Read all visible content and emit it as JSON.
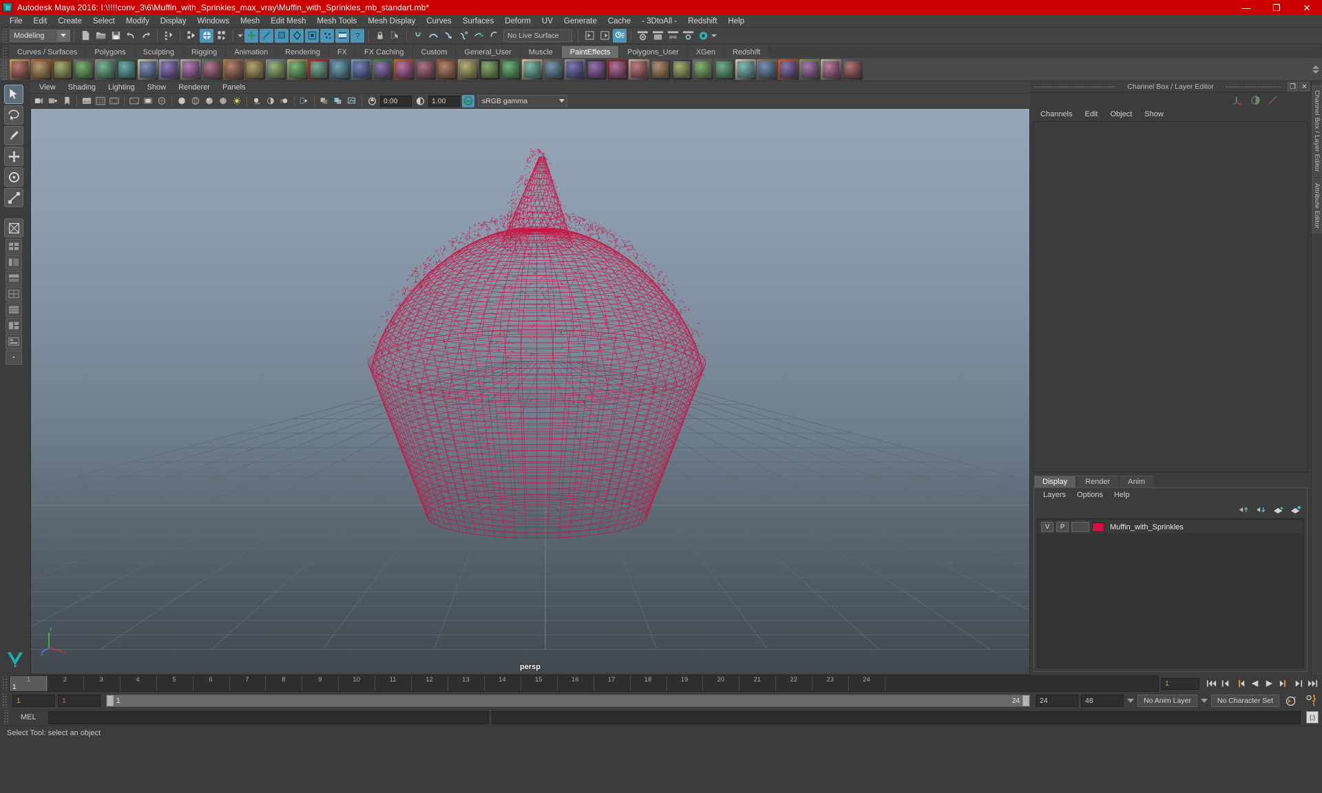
{
  "window": {
    "title": "Autodesk Maya 2016: I:\\!!!!conv_3\\6\\Muffin_with_Sprinkles_max_vray\\Muffin_with_Sprinkles_mb_standart.mb*",
    "minimize": "—",
    "maximize": "❐",
    "close": "✕",
    "titlebar_color": "#cc0000"
  },
  "menubar": {
    "items": [
      "File",
      "Edit",
      "Create",
      "Select",
      "Modify",
      "Display",
      "Windows",
      "Mesh",
      "Edit Mesh",
      "Mesh Tools",
      "Mesh Display",
      "Curves",
      "Surfaces",
      "Deform",
      "UV",
      "Generate",
      "Cache",
      "- 3DtoAll -",
      "Redshift",
      "Help"
    ]
  },
  "statusline": {
    "mode": "Modeling",
    "live_surface": "No Live Surface"
  },
  "shelf": {
    "tabs": [
      "Curves / Surfaces",
      "Polygons",
      "Sculpting",
      "Rigging",
      "Animation",
      "Rendering",
      "FX",
      "FX Caching",
      "Custom",
      "General_User",
      "Muscle",
      "PaintEffects",
      "Polygons_User",
      "XGen",
      "Redshift"
    ],
    "active_tab": "PaintEffects",
    "icon_colors": [
      "#c8a060",
      "#b86a3a",
      "#7a5030",
      "#6a6a6a",
      "#8a8a8a",
      "#3a5a3a",
      "#c8c8b0",
      "#9aa8b8",
      "#b0b0a0",
      "#5a7a5a",
      "#a08050",
      "#8a6a4a",
      "#7a8a9a",
      "#c0a070",
      "#b03030",
      "#5a7a9a",
      "#7a9ab0",
      "#4a8a4a",
      "#c06030",
      "#606060",
      "#8a5a3a",
      "#a09070",
      "#3a3a3a",
      "#507050",
      "#d0c0a0",
      "#7a6a5a",
      "#909090",
      "#404040",
      "#8a3030",
      "#c0b0a0",
      "#505050",
      "#3a4a5a",
      "#707070",
      "#5a5a5a",
      "#d8c8b8",
      "#8a7a6a",
      "#c86030",
      "#7a9a60",
      "#b8b0a0",
      "#5a5a6a"
    ]
  },
  "viewport": {
    "menus": [
      "View",
      "Shading",
      "Lighting",
      "Show",
      "Renderer",
      "Panels"
    ],
    "exposure": "0.00",
    "gamma": "1.00",
    "color_profile": "sRGB gamma",
    "camera_label": "persp",
    "wireframe_color": "#cc1040",
    "axis_labels": {
      "x": "x",
      "y": "y",
      "z": "z"
    }
  },
  "channelbox": {
    "panel_title": "Channel Box / Layer Editor",
    "menus": [
      "Channels",
      "Edit",
      "Object",
      "Show"
    ],
    "undock_glyph": "❐",
    "close_glyph": "✕",
    "dock_label": "Channel Box / Layer Editor",
    "dock_label_2": "Attribute Editor"
  },
  "layereditor": {
    "tabs": [
      "Display",
      "Render",
      "Anim"
    ],
    "active_tab": "Display",
    "menus": [
      "Layers",
      "Options",
      "Help"
    ],
    "layers": [
      {
        "visible": "V",
        "playback": "P",
        "type": "",
        "color": "#cc1040",
        "name": "Muffin_with_Sprinkles"
      }
    ]
  },
  "timeline": {
    "ticks": [
      1,
      2,
      3,
      4,
      5,
      6,
      7,
      8,
      9,
      10,
      11,
      12,
      13,
      14,
      15,
      16,
      17,
      18,
      19,
      20,
      21,
      22,
      23,
      24
    ],
    "current_frame_label": "1",
    "current_frame_field": "1",
    "range_start": "1",
    "range_end": "1",
    "playback_start": "1",
    "playback_end": "24",
    "anim_start": "24",
    "anim_end": "48",
    "anim_layer": "No Anim Layer",
    "character_set": "No Character Set"
  },
  "commandline": {
    "label": "MEL",
    "input_value": "",
    "output_value": ""
  },
  "statusbar": {
    "message": "Select Tool: select an object"
  },
  "toolbox": {
    "tools": [
      "select-tool",
      "lasso-tool",
      "paint-select-tool",
      "move-tool",
      "rotate-tool",
      "scale-tool"
    ],
    "layout_tools": [
      "single-perspective-layout",
      "four-view-layout",
      "outliner-persp-layout",
      "persp-graph-layout",
      "hypershade-persp-layout",
      "two-pane-layout",
      "three-pane-layout",
      "persp-outliner-layout",
      "more-layouts"
    ]
  }
}
